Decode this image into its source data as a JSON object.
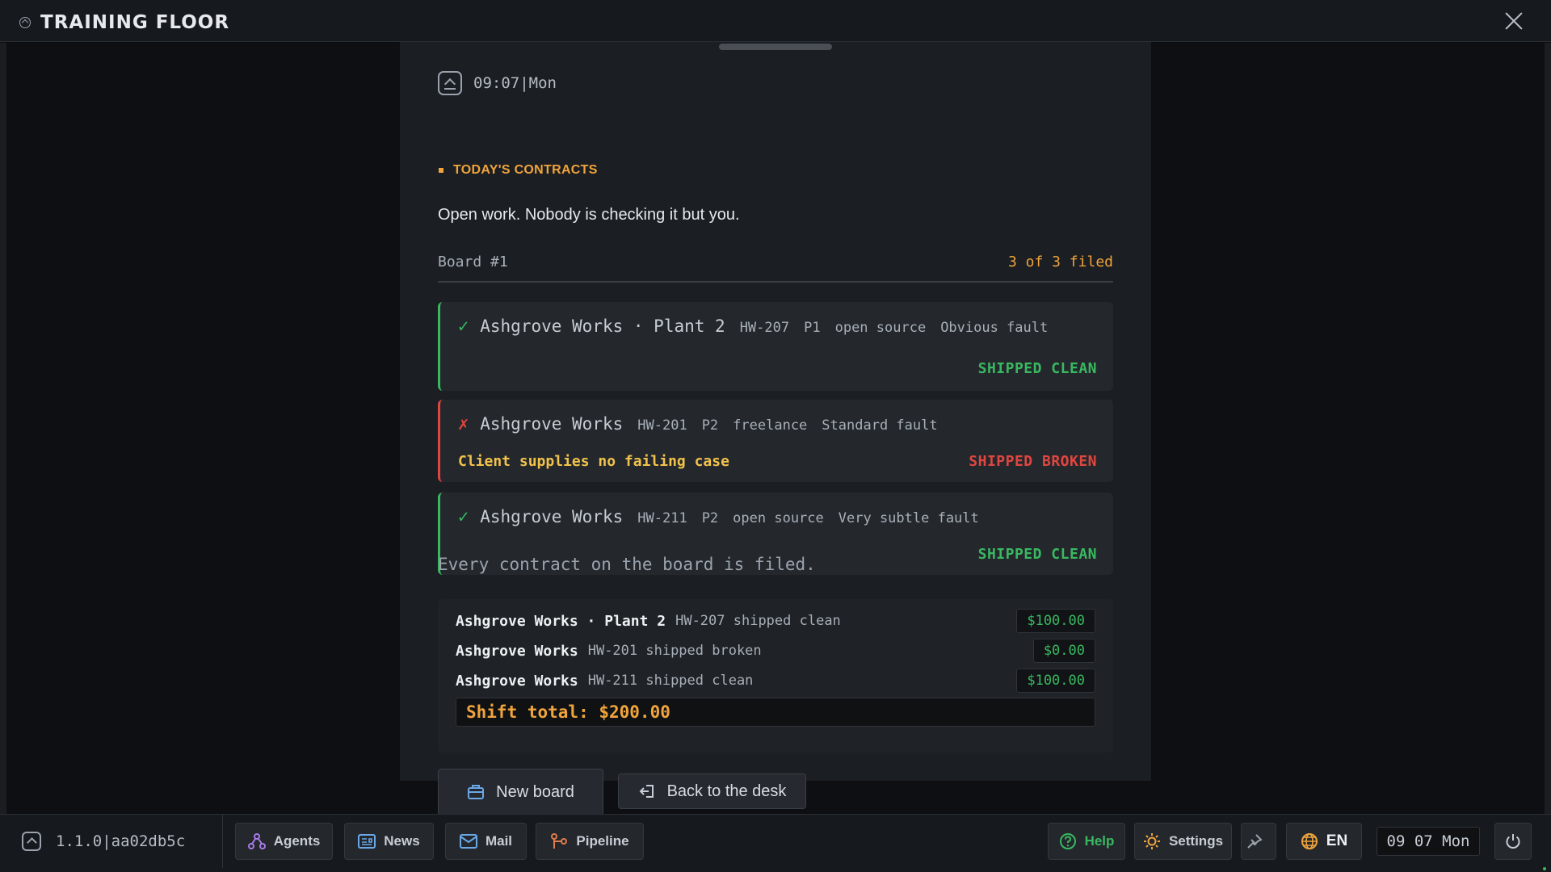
{
  "window": {
    "title": "TRAINING FLOOR"
  },
  "panel": {
    "time": "09:07|Mon",
    "section_tag": "TODAY'S CONTRACTS",
    "intro": "Open work. Nobody is checking it but you.",
    "board_label": "Board #1",
    "board_count": "3 of 3 filed",
    "done_line": "Every contract on the board is filed."
  },
  "contracts": [
    {
      "mark": "✓",
      "client": "Ashgrove Works · Plant 2",
      "ticket": "HW-207",
      "priority": "P1",
      "kind": "open source",
      "fault": "Obvious fault",
      "note": "",
      "status": "SHIPPED CLEAN",
      "ok": true
    },
    {
      "mark": "✗",
      "client": "Ashgrove Works",
      "ticket": "HW-201",
      "priority": "P2",
      "kind": "freelance",
      "fault": "Standard fault",
      "note": "Client supplies no failing case",
      "status": "SHIPPED BROKEN",
      "ok": false
    },
    {
      "mark": "✓",
      "client": "Ashgrove Works",
      "ticket": "HW-211",
      "priority": "P2",
      "kind": "open source",
      "fault": "Very subtle fault",
      "note": "",
      "status": "SHIPPED CLEAN",
      "ok": true
    }
  ],
  "ledger": {
    "rows": [
      {
        "name": "Ashgrove Works · Plant 2",
        "desc": "HW-207 shipped clean",
        "amount": "$100.00"
      },
      {
        "name": "Ashgrove Works",
        "desc": "HW-201 shipped broken",
        "amount": "$0.00"
      },
      {
        "name": "Ashgrove Works",
        "desc": "HW-211 shipped clean",
        "amount": "$100.00"
      }
    ],
    "total": "Shift total: $200.00"
  },
  "actions": {
    "new_board": "New board",
    "back": "Back to the desk"
  },
  "bottombar": {
    "version": "1.1.0|aa02db5c",
    "nav": [
      "Agents",
      "News",
      "Mail",
      "Pipeline"
    ],
    "help": "Help",
    "settings": "Settings",
    "language": "EN",
    "clock": "09 07 Mon"
  },
  "colors": {
    "accent": "#f0a43c",
    "ok": "#39b860",
    "bad": "#e0463f",
    "warn": "#f2c24a"
  }
}
